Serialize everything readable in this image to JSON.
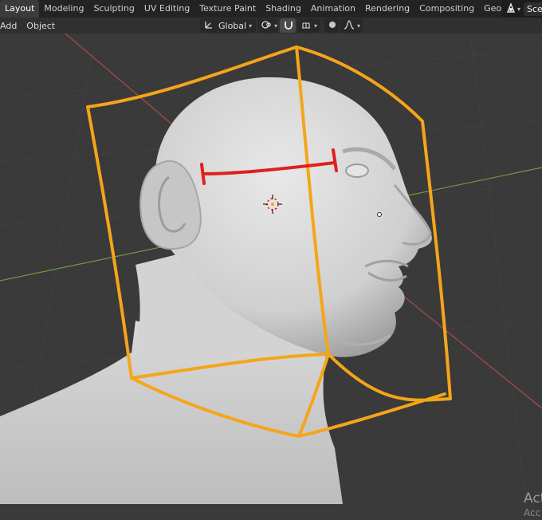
{
  "workspace_tabs": [
    {
      "label": "Layout",
      "active": true
    },
    {
      "label": "Modeling"
    },
    {
      "label": "Sculpting"
    },
    {
      "label": "UV Editing"
    },
    {
      "label": "Texture Paint"
    },
    {
      "label": "Shading"
    },
    {
      "label": "Animation"
    },
    {
      "label": "Rendering"
    },
    {
      "label": "Compositing"
    },
    {
      "label": "Geometry Nod"
    }
  ],
  "scene": {
    "name": "Sce"
  },
  "header": {
    "menu": [
      "Add",
      "Object"
    ],
    "transform_orientation": "Global"
  },
  "overlay_watermark": {
    "line1": "Act",
    "line2": "Acc"
  },
  "colors": {
    "annotation_orange": "#f5a51a",
    "annotation_red": "#e01f1f",
    "axis_x": "#b24a4a",
    "axis_y": "#6f9a3a",
    "viewport_bg": "#3a3a3a"
  }
}
